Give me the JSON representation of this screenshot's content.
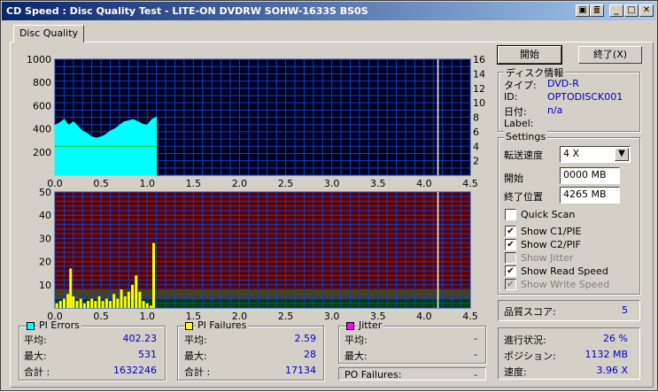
{
  "window": {
    "title": "CD Speed : Disc Quality Test - LITE-ON DVDRW SOHW-1633S BS0S"
  },
  "tab": {
    "label": "Disc Quality"
  },
  "buttons": {
    "start": "開始",
    "exit": "終了(X)"
  },
  "disc_info": {
    "group_title": "ディスク情報",
    "type_label": "タイプ:",
    "type_value": "DVD-R",
    "id_label": "ID:",
    "id_value": "OPTODISCK001",
    "date_label": "日付:",
    "date_value": "n/a",
    "label_label": "Label:",
    "label_value": ""
  },
  "settings": {
    "group_title": "Settings",
    "speed_label": "転送速度",
    "speed_value": "4 X",
    "start_label": "開始",
    "start_value": "0000 MB",
    "end_label": "終了位置",
    "end_value": "4265 MB",
    "quick_scan": "Quick Scan",
    "quick_scan_checked": false,
    "show_c1": "Show C1/PIE",
    "show_c1_checked": true,
    "show_c2": "Show C2/PIF",
    "show_c2_checked": true,
    "show_jitter": "Show Jitter",
    "show_jitter_checked": false,
    "show_read": "Show Read Speed",
    "show_read_checked": true,
    "show_write": "Show Write Speed",
    "show_write_checked": true
  },
  "quality": {
    "label": "品質スコア:",
    "value": "5"
  },
  "progress": {
    "progress_label": "進行状況:",
    "progress_value": "26 %",
    "position_label": "ポジション:",
    "position_value": "1132 MB",
    "speed_label": "速度:",
    "speed_value": "3.96 X"
  },
  "pi_errors": {
    "title": "PI Errors",
    "color": "#00ffff",
    "avg_label": "平均:",
    "avg": "402.23",
    "max_label": "最大:",
    "max": "531",
    "total_label": "合計 :",
    "total": "1632246"
  },
  "pi_failures": {
    "title": "PI Failures",
    "color": "#ffff00",
    "avg_label": "平均:",
    "avg": "2.59",
    "max_label": "最大:",
    "max": "28",
    "total_label": "合計 :",
    "total": "17134"
  },
  "jitter": {
    "title": "Jitter",
    "color": "#ff00ff",
    "avg_label": "平均:",
    "avg": "-",
    "max_label": "最大:",
    "max": "-"
  },
  "po_failures": {
    "label": "PO Failures:",
    "value": "-"
  },
  "chart_data": [
    {
      "type": "area",
      "x_ticks": [
        "0.0",
        "0.5",
        "1.0",
        "1.5",
        "2.0",
        "2.5",
        "3.0",
        "3.5",
        "4.0",
        "4.5"
      ],
      "y_left_ticks": [
        "1000",
        "800",
        "600",
        "400",
        "200"
      ],
      "y_right_ticks": [
        "16",
        "14",
        "12",
        "10",
        "8",
        "6",
        "4",
        "2"
      ],
      "xlim": [
        0,
        4.5
      ],
      "ylim": [
        0,
        1000
      ],
      "y2lim": [
        0,
        16
      ],
      "marker_x": 4.15,
      "series": [
        {
          "color": "#00ffff",
          "x": [
            0,
            0.05,
            0.1,
            0.15,
            0.2,
            0.25,
            0.3,
            0.35,
            0.4,
            0.45,
            0.5,
            0.55,
            0.6,
            0.65,
            0.7,
            0.75,
            0.8,
            0.85,
            0.9,
            0.95,
            1.0,
            1.05,
            1.1
          ],
          "y": [
            430,
            450,
            480,
            430,
            460,
            420,
            380,
            360,
            330,
            320,
            330,
            350,
            380,
            400,
            430,
            460,
            470,
            480,
            460,
            440,
            430,
            480,
            500
          ]
        },
        {
          "color": "#00c000",
          "x": [
            0,
            1.1
          ],
          "y": [
            4,
            4
          ]
        }
      ]
    },
    {
      "type": "bar",
      "x_ticks": [
        "0.0",
        "0.5",
        "1.0",
        "1.5",
        "2.0",
        "2.5",
        "3.0",
        "3.5",
        "4.0",
        "4.5"
      ],
      "y_ticks": [
        "50",
        "40",
        "30",
        "20",
        "10"
      ],
      "xlim": [
        0,
        4.5
      ],
      "ylim": [
        0,
        50
      ],
      "marker_x": 4.15,
      "series": [
        {
          "color": "#ffff00",
          "x": [
            0.02,
            0.06,
            0.1,
            0.14,
            0.17,
            0.2,
            0.24,
            0.28,
            0.32,
            0.36,
            0.4,
            0.44,
            0.48,
            0.52,
            0.56,
            0.6,
            0.64,
            0.68,
            0.72,
            0.76,
            0.8,
            0.84,
            0.88,
            0.92,
            0.96,
            1.0,
            1.04,
            1.07
          ],
          "y": [
            2,
            3,
            4,
            6,
            17,
            5,
            3,
            4,
            2,
            3,
            4,
            3,
            5,
            3,
            4,
            3,
            6,
            4,
            8,
            5,
            7,
            10,
            14,
            7,
            3,
            2,
            1,
            28
          ]
        }
      ]
    }
  ]
}
